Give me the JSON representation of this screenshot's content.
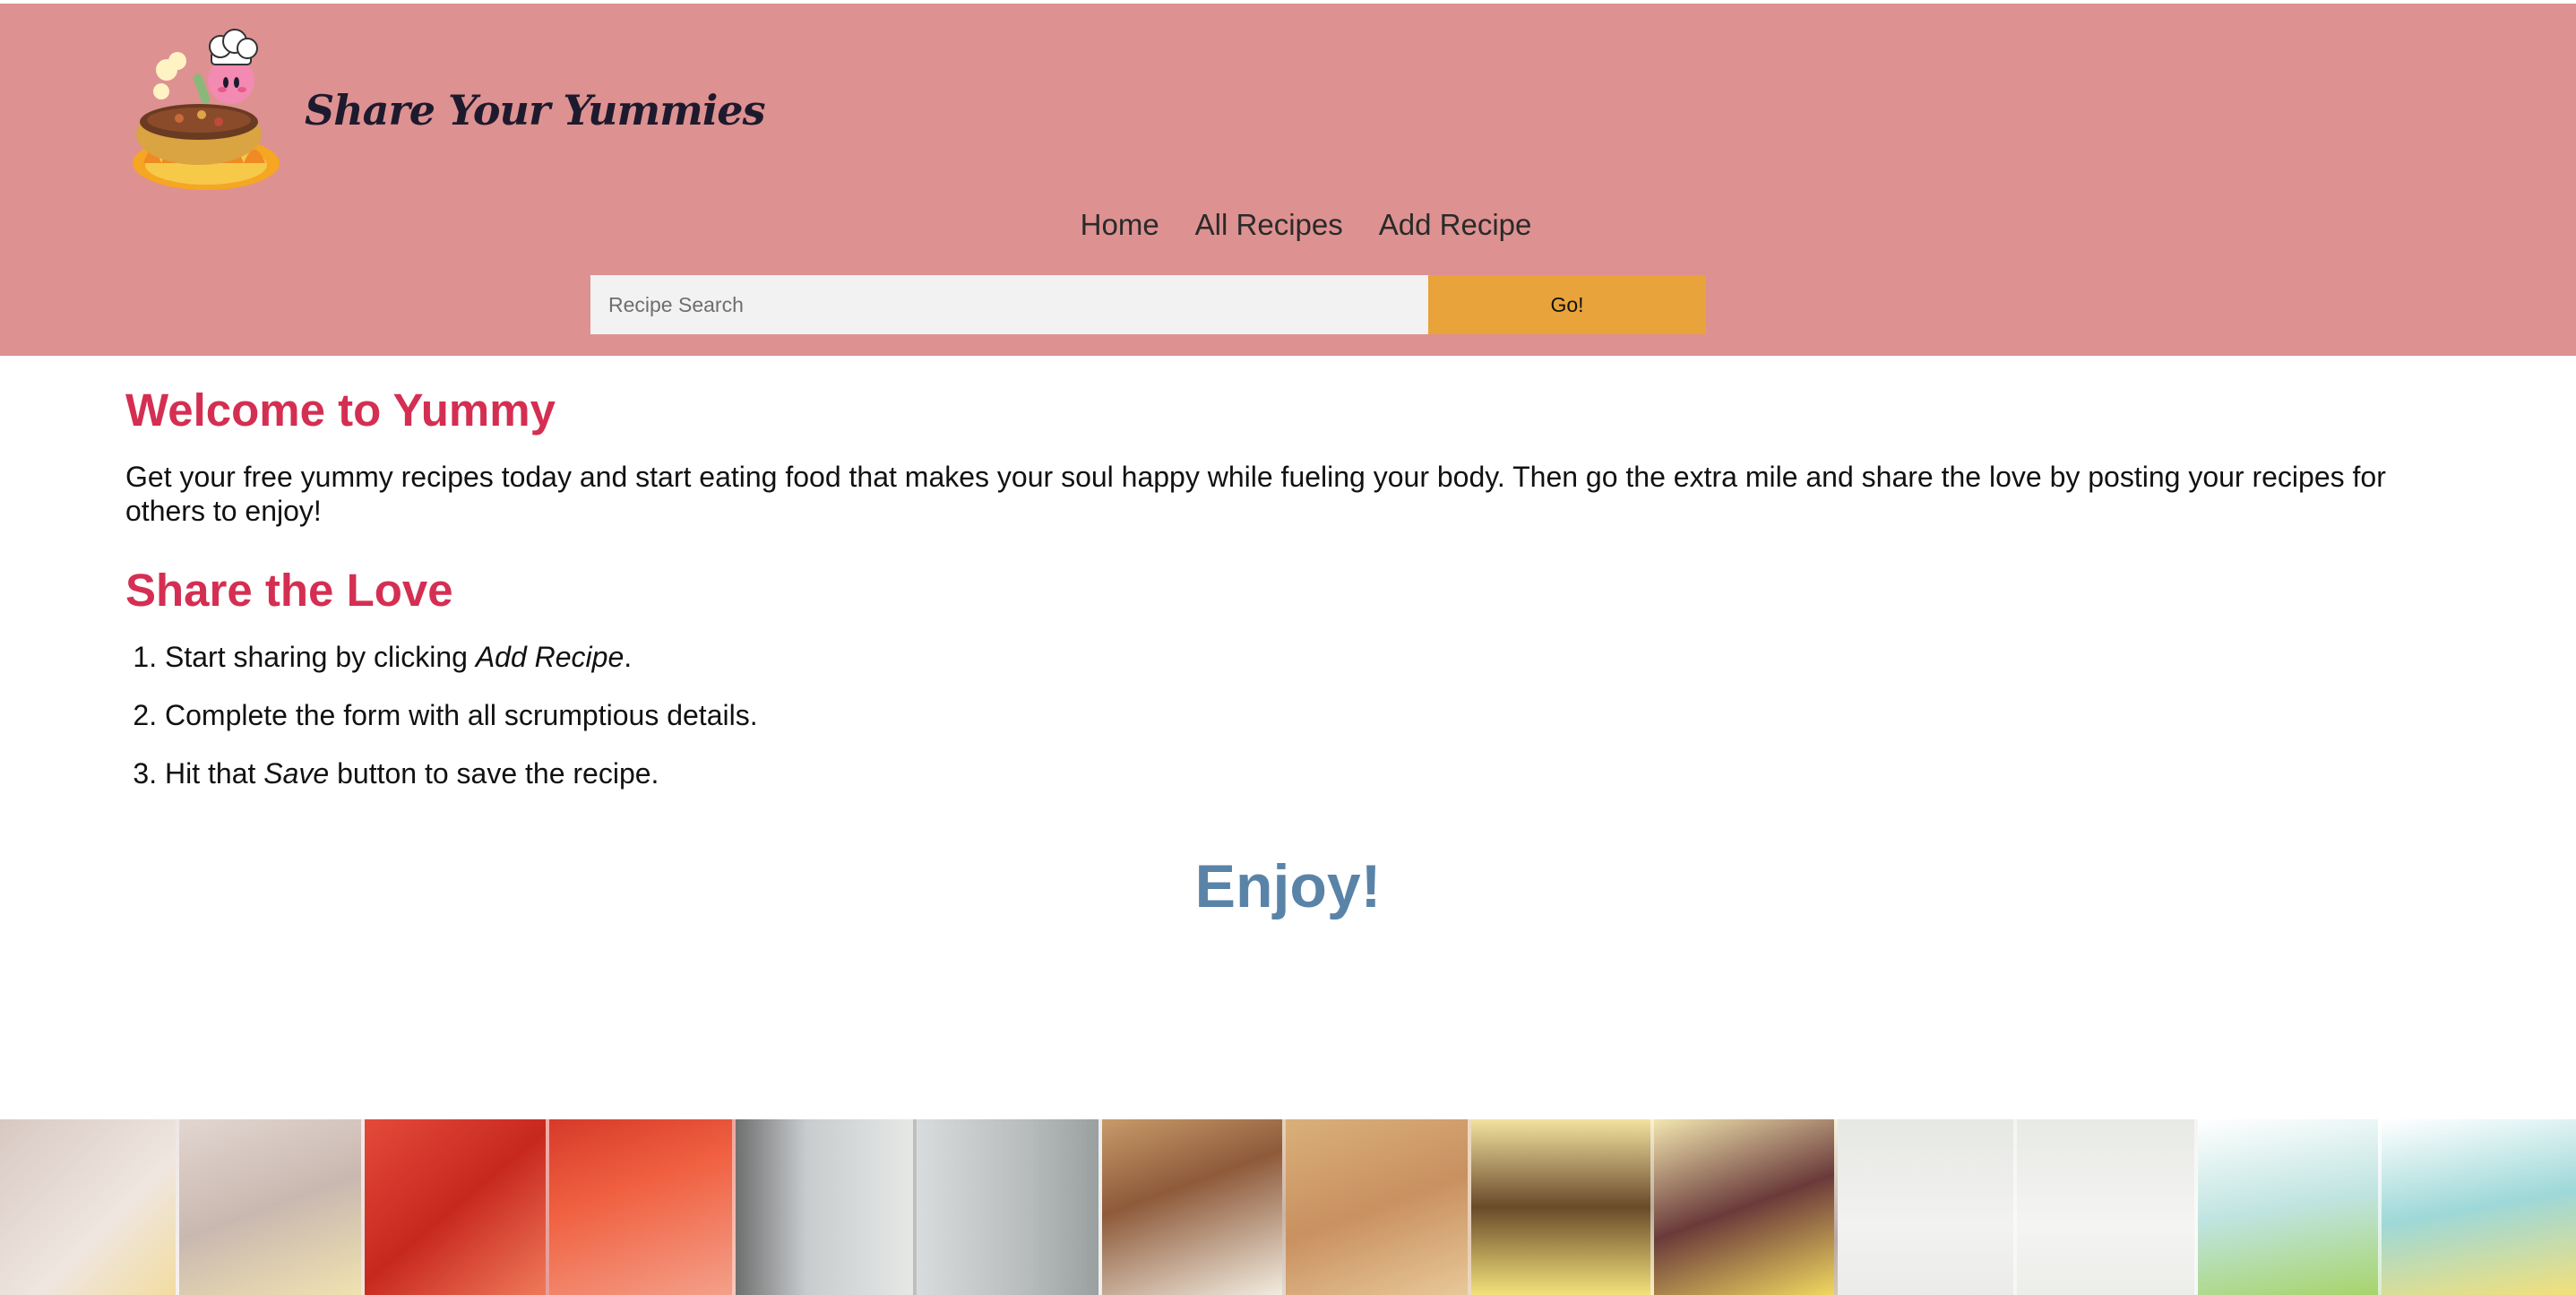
{
  "site": {
    "brand_name": "Share Your Yummies",
    "logo_icon": "chef-pot-logo"
  },
  "nav": {
    "items": [
      {
        "label": "Home"
      },
      {
        "label": "All Recipes"
      },
      {
        "label": "Add Recipe"
      }
    ]
  },
  "search": {
    "placeholder": "Recipe Search",
    "value": "",
    "button_label": "Go!"
  },
  "main": {
    "welcome_title": "Welcome to Yummy",
    "intro_text": "Get your free yummy recipes today and start eating food that makes your soul happy while fueling your body. Then go the extra mile and share the love by posting your recipes for others to enjoy!",
    "share_title": "Share the Love",
    "steps": [
      {
        "before": "Start sharing by clicking ",
        "emph": "Add Recipe",
        "after": "."
      },
      {
        "before": "Complete the form with all scrumptious details.",
        "emph": "",
        "after": ""
      },
      {
        "before": "Hit that ",
        "emph": "Save",
        "after": " button to save the recipe."
      }
    ],
    "closing": "Enjoy!"
  },
  "colors": {
    "header_bg": "#de9191",
    "heading_red": "#d42f52",
    "enjoy_blue": "#5a83a8",
    "button_orange": "#e8a33a",
    "input_bg": "#f2f2f2"
  }
}
